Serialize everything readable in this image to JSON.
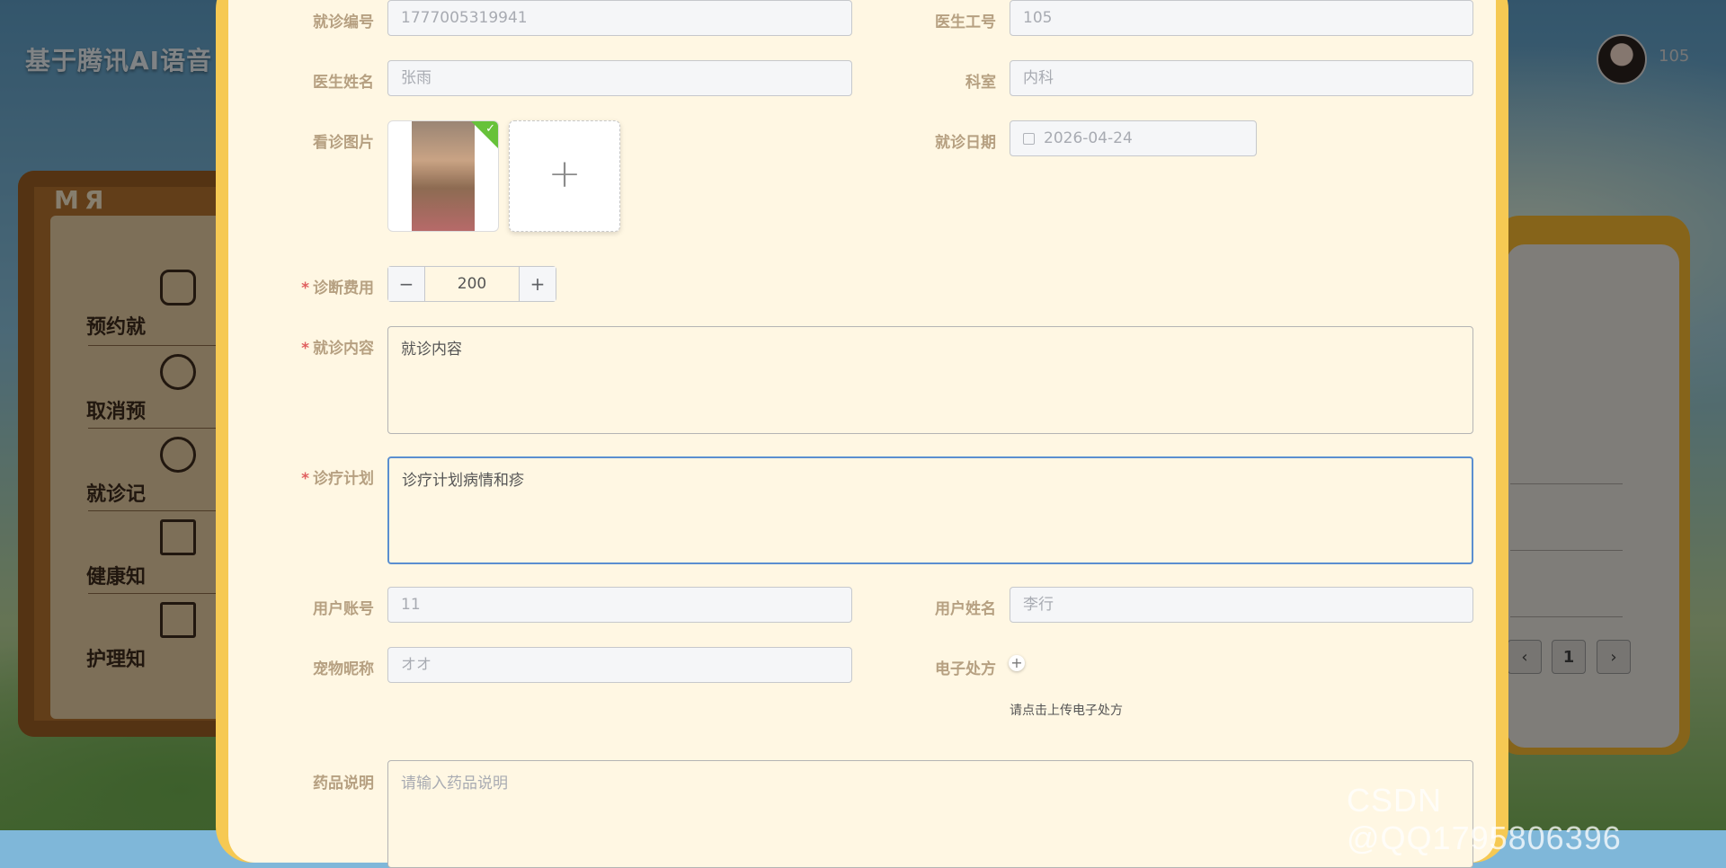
{
  "background": {
    "app_title": "基于腾讯AI语音",
    "user_id": "105",
    "board_sign": "MЯ",
    "sidebar": [
      "预约就",
      "取消预",
      "就诊记",
      "健康知",
      "护理知"
    ],
    "pager": {
      "prev": "‹",
      "page": "1",
      "next": "›"
    }
  },
  "form": {
    "visit_no": {
      "label": "就诊编号",
      "value": "1777005319941"
    },
    "doctor_no": {
      "label": "医生工号",
      "value": "105"
    },
    "doctor_name": {
      "label": "医生姓名",
      "value": "张雨"
    },
    "department": {
      "label": "科室",
      "value": "内科"
    },
    "visit_image": {
      "label": "看诊图片",
      "add": "+",
      "check": "✓"
    },
    "visit_date": {
      "label": "就诊日期",
      "value": "2026-04-24"
    },
    "fee": {
      "label": "诊断费用",
      "required": "*",
      "value": "200",
      "minus": "−",
      "plus": "+"
    },
    "content": {
      "label": "就诊内容",
      "required": "*",
      "value": "就诊内容"
    },
    "plan": {
      "label": "诊疗计划",
      "required": "*",
      "value": "诊疗计划病情和疹"
    },
    "user_account": {
      "label": "用户账号",
      "value": "11"
    },
    "user_name": {
      "label": "用户姓名",
      "value": "李行"
    },
    "pet_name": {
      "label": "宠物昵称",
      "value": "オオ"
    },
    "prescription": {
      "label": "电子处方",
      "add": "+",
      "hint": "请点击上传电子处方"
    },
    "drug_desc": {
      "label": "药品说明",
      "placeholder": "请输入药品说明"
    }
  },
  "watermark": "CSDN @QQ1795806396",
  "colors": {
    "accent": "#5b8fd0",
    "dialog_bg": "#fff7e3",
    "frame": "#f6c953",
    "success": "#67c23a"
  }
}
